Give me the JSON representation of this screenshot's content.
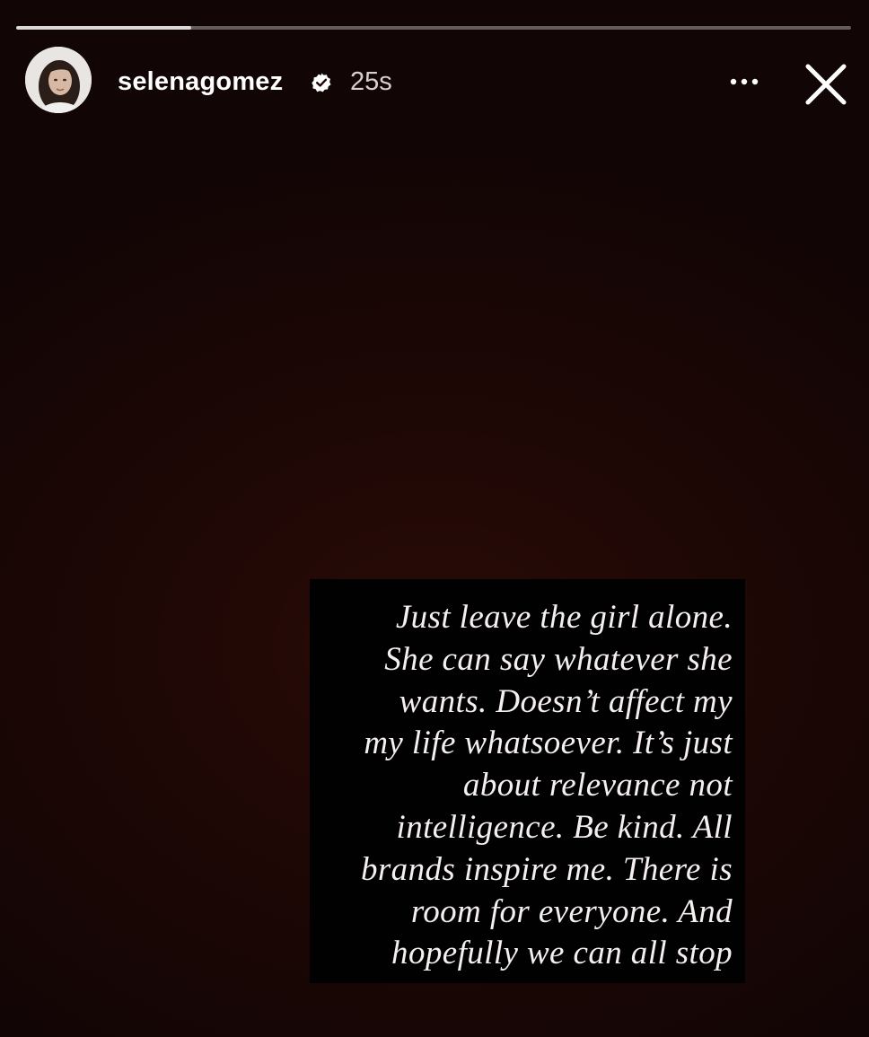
{
  "story": {
    "progress_fraction": 0.21,
    "background_color": "#1b0705"
  },
  "header": {
    "username": "selenagomez",
    "verified_icon": "verified-badge-icon",
    "timestamp": "25s",
    "more_icon": "more-horizontal-icon",
    "close_icon": "close-icon"
  },
  "caption": {
    "lines": [
      "Just leave the girl alone.",
      "She can say whatever she",
      "wants. Doesn’t affect my",
      "my life whatsoever. It’s just",
      "about relevance not",
      "intelligence. Be kind. All",
      "brands inspire me. There is",
      "room for everyone.  And",
      "hopefully we can all stop"
    ]
  }
}
